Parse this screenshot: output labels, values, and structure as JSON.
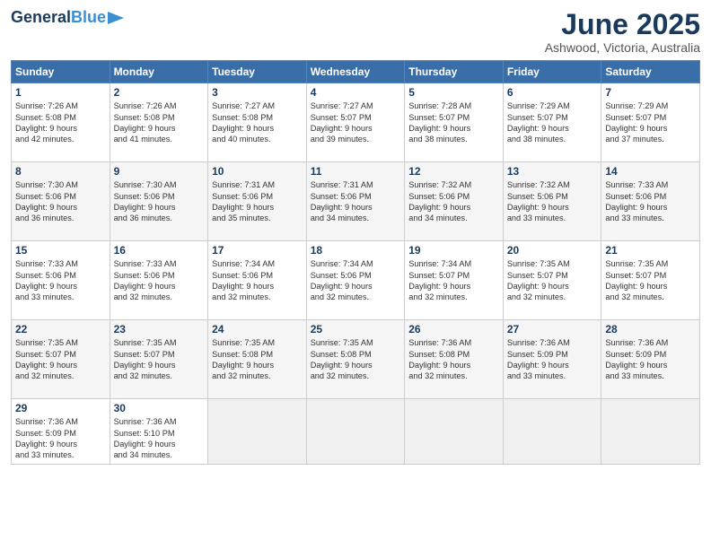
{
  "logo": {
    "line1": "General",
    "line2": "Blue"
  },
  "title": "June 2025",
  "location": "Ashwood, Victoria, Australia",
  "headers": [
    "Sunday",
    "Monday",
    "Tuesday",
    "Wednesday",
    "Thursday",
    "Friday",
    "Saturday"
  ],
  "weeks": [
    [
      {
        "day": "1",
        "sunrise": "7:26 AM",
        "sunset": "5:08 PM",
        "daylight": "9 hours and 42 minutes."
      },
      {
        "day": "2",
        "sunrise": "7:26 AM",
        "sunset": "5:08 PM",
        "daylight": "9 hours and 41 minutes."
      },
      {
        "day": "3",
        "sunrise": "7:27 AM",
        "sunset": "5:08 PM",
        "daylight": "9 hours and 40 minutes."
      },
      {
        "day": "4",
        "sunrise": "7:27 AM",
        "sunset": "5:07 PM",
        "daylight": "9 hours and 39 minutes."
      },
      {
        "day": "5",
        "sunrise": "7:28 AM",
        "sunset": "5:07 PM",
        "daylight": "9 hours and 38 minutes."
      },
      {
        "day": "6",
        "sunrise": "7:29 AM",
        "sunset": "5:07 PM",
        "daylight": "9 hours and 38 minutes."
      },
      {
        "day": "7",
        "sunrise": "7:29 AM",
        "sunset": "5:07 PM",
        "daylight": "9 hours and 37 minutes."
      }
    ],
    [
      {
        "day": "8",
        "sunrise": "7:30 AM",
        "sunset": "5:06 PM",
        "daylight": "9 hours and 36 minutes."
      },
      {
        "day": "9",
        "sunrise": "7:30 AM",
        "sunset": "5:06 PM",
        "daylight": "9 hours and 36 minutes."
      },
      {
        "day": "10",
        "sunrise": "7:31 AM",
        "sunset": "5:06 PM",
        "daylight": "9 hours and 35 minutes."
      },
      {
        "day": "11",
        "sunrise": "7:31 AM",
        "sunset": "5:06 PM",
        "daylight": "9 hours and 34 minutes."
      },
      {
        "day": "12",
        "sunrise": "7:32 AM",
        "sunset": "5:06 PM",
        "daylight": "9 hours and 34 minutes."
      },
      {
        "day": "13",
        "sunrise": "7:32 AM",
        "sunset": "5:06 PM",
        "daylight": "9 hours and 33 minutes."
      },
      {
        "day": "14",
        "sunrise": "7:33 AM",
        "sunset": "5:06 PM",
        "daylight": "9 hours and 33 minutes."
      }
    ],
    [
      {
        "day": "15",
        "sunrise": "7:33 AM",
        "sunset": "5:06 PM",
        "daylight": "9 hours and 33 minutes."
      },
      {
        "day": "16",
        "sunrise": "7:33 AM",
        "sunset": "5:06 PM",
        "daylight": "9 hours and 32 minutes."
      },
      {
        "day": "17",
        "sunrise": "7:34 AM",
        "sunset": "5:06 PM",
        "daylight": "9 hours and 32 minutes."
      },
      {
        "day": "18",
        "sunrise": "7:34 AM",
        "sunset": "5:06 PM",
        "daylight": "9 hours and 32 minutes."
      },
      {
        "day": "19",
        "sunrise": "7:34 AM",
        "sunset": "5:07 PM",
        "daylight": "9 hours and 32 minutes."
      },
      {
        "day": "20",
        "sunrise": "7:35 AM",
        "sunset": "5:07 PM",
        "daylight": "9 hours and 32 minutes."
      },
      {
        "day": "21",
        "sunrise": "7:35 AM",
        "sunset": "5:07 PM",
        "daylight": "9 hours and 32 minutes."
      }
    ],
    [
      {
        "day": "22",
        "sunrise": "7:35 AM",
        "sunset": "5:07 PM",
        "daylight": "9 hours and 32 minutes."
      },
      {
        "day": "23",
        "sunrise": "7:35 AM",
        "sunset": "5:07 PM",
        "daylight": "9 hours and 32 minutes."
      },
      {
        "day": "24",
        "sunrise": "7:35 AM",
        "sunset": "5:08 PM",
        "daylight": "9 hours and 32 minutes."
      },
      {
        "day": "25",
        "sunrise": "7:35 AM",
        "sunset": "5:08 PM",
        "daylight": "9 hours and 32 minutes."
      },
      {
        "day": "26",
        "sunrise": "7:36 AM",
        "sunset": "5:08 PM",
        "daylight": "9 hours and 32 minutes."
      },
      {
        "day": "27",
        "sunrise": "7:36 AM",
        "sunset": "5:09 PM",
        "daylight": "9 hours and 33 minutes."
      },
      {
        "day": "28",
        "sunrise": "7:36 AM",
        "sunset": "5:09 PM",
        "daylight": "9 hours and 33 minutes."
      }
    ],
    [
      {
        "day": "29",
        "sunrise": "7:36 AM",
        "sunset": "5:09 PM",
        "daylight": "9 hours and 33 minutes."
      },
      {
        "day": "30",
        "sunrise": "7:36 AM",
        "sunset": "5:10 PM",
        "daylight": "9 hours and 34 minutes."
      },
      {
        "day": "",
        "sunrise": "",
        "sunset": "",
        "daylight": ""
      },
      {
        "day": "",
        "sunrise": "",
        "sunset": "",
        "daylight": ""
      },
      {
        "day": "",
        "sunrise": "",
        "sunset": "",
        "daylight": ""
      },
      {
        "day": "",
        "sunrise": "",
        "sunset": "",
        "daylight": ""
      },
      {
        "day": "",
        "sunrise": "",
        "sunset": "",
        "daylight": ""
      }
    ]
  ],
  "labels": {
    "sunrise": "Sunrise:",
    "sunset": "Sunset:",
    "daylight": "Daylight:"
  }
}
